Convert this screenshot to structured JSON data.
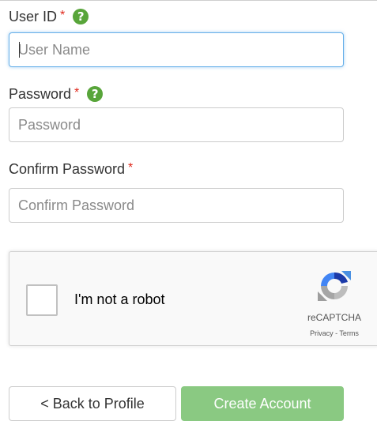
{
  "form": {
    "user_id": {
      "label": "User ID",
      "required_mark": "*",
      "help_icon": "question-circle-icon",
      "placeholder": "User Name"
    },
    "password": {
      "label": "Password",
      "required_mark": "*",
      "help_icon": "question-circle-icon",
      "placeholder": "Password"
    },
    "confirm_password": {
      "label": "Confirm Password",
      "required_mark": "*",
      "placeholder": "Confirm Password"
    }
  },
  "recaptcha": {
    "label": "I'm not a robot",
    "brand": "reCAPTCHA",
    "links": "Privacy - Terms",
    "logo_icon": "recaptcha-logo-icon"
  },
  "buttons": {
    "back_label": "< Back to Profile",
    "create_label": "Create Account"
  },
  "colors": {
    "required": "#e0281c",
    "help_icon": "#58a53a",
    "create_button": "#8ac982",
    "focus_border": "#66afe9"
  }
}
